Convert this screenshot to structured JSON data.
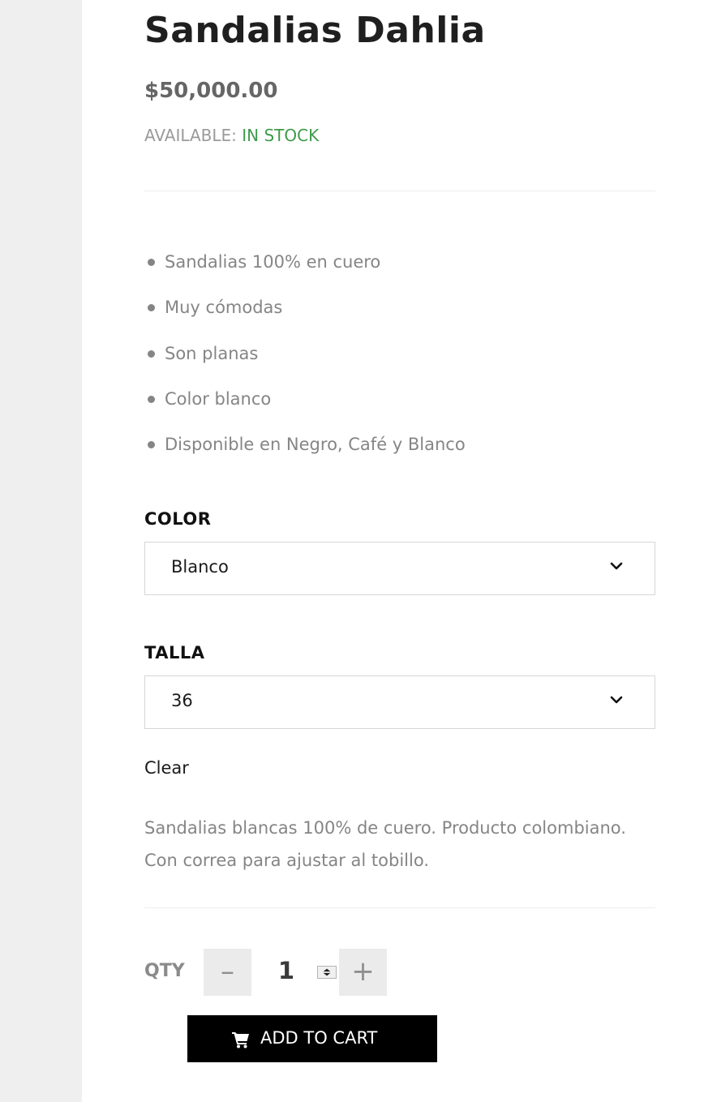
{
  "product": {
    "title": "Sandalias Dahlia",
    "price": "$50,000.00",
    "availability_label": "AVAILABLE:",
    "availability_value": "IN STOCK"
  },
  "features": [
    "Sandalias 100% en cuero",
    "Muy cómodas",
    "Son planas",
    "Color blanco",
    "Disponible en Negro, Café y Blanco"
  ],
  "variations": {
    "color": {
      "label": "COLOR",
      "selected": "Blanco"
    },
    "talla": {
      "label": "TALLA",
      "selected": "36"
    },
    "clear_label": "Clear"
  },
  "description": "Sandalias blancas 100% de cuero. Producto colombiano. Con correa para ajustar al tobillo.",
  "quantity": {
    "label": "QTY",
    "value": "1",
    "minus_label": "–",
    "plus_label": "+"
  },
  "cart_button": {
    "label": "ADD TO CART"
  },
  "colors": {
    "in_stock": "#3f9a4a",
    "button_bg": "#000000",
    "sidebar_bg": "#efefef"
  },
  "icons": {
    "select_arrow": "chevron-down-icon",
    "cart": "cart-icon",
    "spinner": "spinner-arrows-icon"
  }
}
